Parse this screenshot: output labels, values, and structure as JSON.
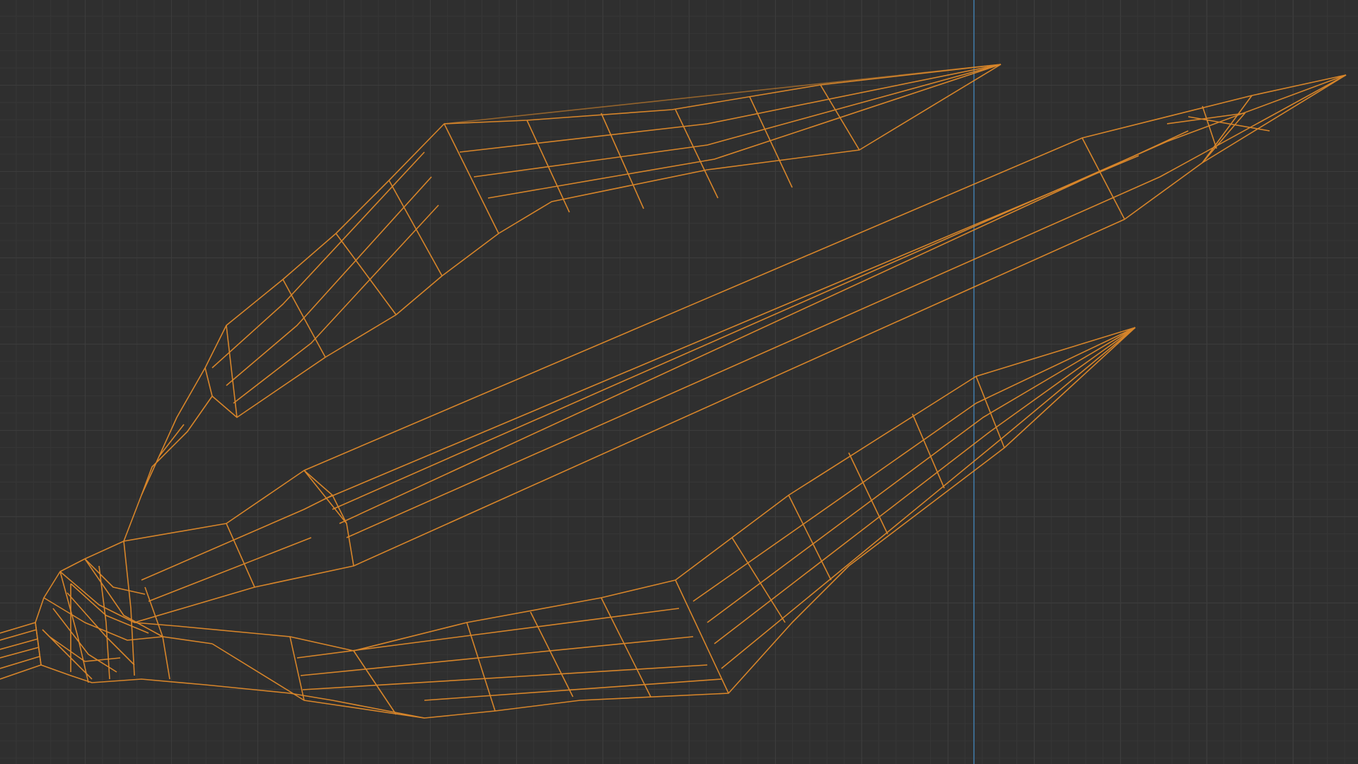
{
  "viewport": {
    "background_color": "#2f2f2f",
    "grid_major_color": "#3c3c3c",
    "grid_minor_color": "#363636",
    "axis_color": "#3e6f96"
  },
  "object": {
    "kind": "trident-mesh",
    "display_mode": "wireframe",
    "selected": true,
    "wire_color": "#e08a2a"
  }
}
